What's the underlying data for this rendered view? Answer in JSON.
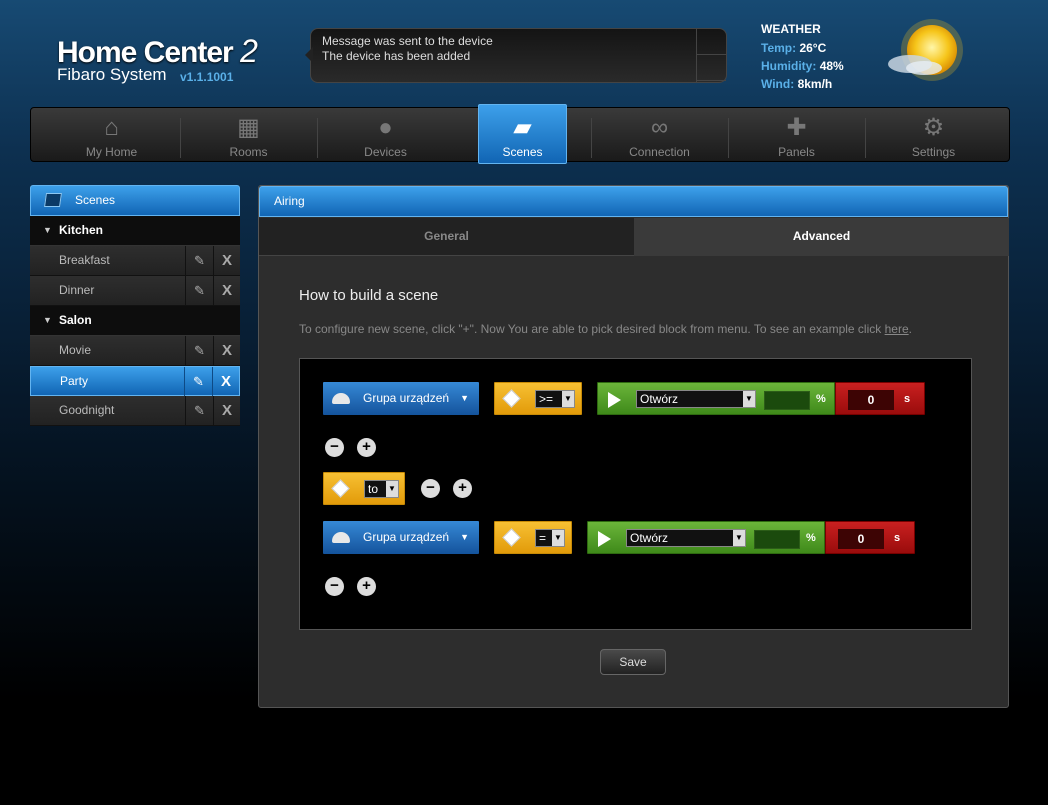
{
  "header": {
    "logo_title": "Home Center",
    "logo_num": "2",
    "logo_sub": "Fibaro System",
    "version": "v1.1.1001",
    "messages": [
      "Message was sent to the device",
      "The device has been added"
    ]
  },
  "weather": {
    "heading": "WEATHER",
    "temp_label": "Temp:",
    "temp_value": "26°C",
    "humidity_label": "Humidity:",
    "humidity_value": "48%",
    "wind_label": "Wind:",
    "wind_value": "8km/h",
    "icon": "sun-cloud-icon"
  },
  "nav": {
    "items": [
      {
        "label": "My Home",
        "icon": "house-icon"
      },
      {
        "label": "Rooms",
        "icon": "floorplan-icon"
      },
      {
        "label": "Devices",
        "icon": "bulb-icon"
      },
      {
        "label": "Scenes",
        "icon": "clapperboard-icon"
      },
      {
        "label": "Connection",
        "icon": "link-icon"
      },
      {
        "label": "Panels",
        "icon": "puzzle-icon"
      },
      {
        "label": "Settings",
        "icon": "gears-icon"
      }
    ],
    "active": "Scenes"
  },
  "sidebar": {
    "title": "Scenes",
    "groups": [
      {
        "name": "Kitchen",
        "items": [
          "Breakfast",
          "Dinner"
        ]
      },
      {
        "name": "Salon",
        "items": [
          "Movie",
          "Party",
          "Goodnight"
        ]
      }
    ],
    "selected": "Party"
  },
  "main": {
    "scene_title": "Airing",
    "tabs": {
      "general": "General",
      "advanced": "Advanced"
    },
    "active_tab": "Advanced",
    "howto_title": "How to build a scene",
    "howto_desc": "To configure new scene, click \"+\". Now You are able to pick desired block from menu. To see an example click",
    "howto_link": "here",
    "howto_end": ".",
    "row1": {
      "device": "Grupa urządzeń",
      "operator": ">=",
      "action": "Otwórz",
      "pct_unit": "%",
      "delay": "0",
      "delay_unit": "s"
    },
    "connector": "to",
    "row2": {
      "device": "Grupa urządzeń",
      "operator": "=",
      "action": "Otwórz",
      "pct_unit": "%",
      "delay": "0",
      "delay_unit": "s"
    },
    "save_label": "Save"
  },
  "colors": {
    "accent_blue": "#1f7fd0",
    "operator_yellow": "#f2b124",
    "action_green": "#53a02a",
    "delay_red": "#b51616"
  }
}
